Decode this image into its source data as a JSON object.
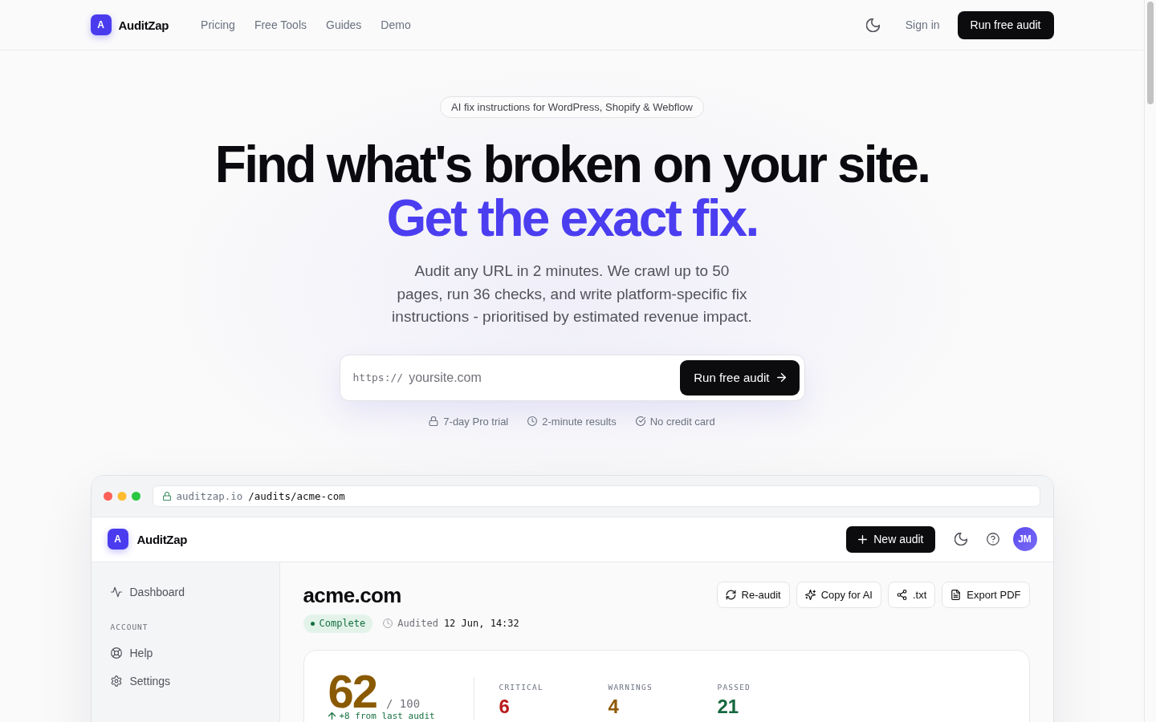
{
  "nav": {
    "logo_letter": "A",
    "brand": "AuditZap",
    "links": [
      {
        "label": "Pricing"
      },
      {
        "label": "Free Tools"
      },
      {
        "label": "Guides"
      },
      {
        "label": "Demo"
      }
    ],
    "sign_in": "Sign in",
    "cta": "Run free audit"
  },
  "hero": {
    "badge": "AI fix instructions for WordPress, Shopify & Webflow",
    "headline": "Find what's broken on your site.",
    "headline_accent": "Get the exact fix.",
    "description": "Audit any URL in 2 minutes. We crawl up to 50 pages, run 36 checks, and write platform-specific fix instructions - prioritised by estimated revenue impact.",
    "url_form": {
      "prefix": "https://",
      "placeholder": "yoursite.com",
      "button": "Run free audit"
    },
    "trust_items": [
      {
        "kind": "lock",
        "label": "7-day Pro trial"
      },
      {
        "kind": "clock",
        "label": "2-minute results"
      },
      {
        "kind": "check",
        "label": "No credit card"
      }
    ]
  },
  "preview": {
    "address_bar": {
      "host": "auditzap.io",
      "path": "/audits/acme-com"
    },
    "app_header": {
      "logo_letter": "A",
      "brand": "AuditZap",
      "new_button": "New audit",
      "avatar": "JM"
    },
    "sidebar": {
      "items": [
        {
          "kind": "activity",
          "label": "Dashboard"
        }
      ],
      "sections": [
        {
          "heading": "ACCOUNT",
          "items": [
            {
              "kind": "help",
              "label": "Help"
            },
            {
              "kind": "settings",
              "label": "Settings"
            }
          ]
        }
      ]
    },
    "audit": {
      "site": "acme.com",
      "status": "Complete",
      "audited_label": "Audited",
      "audited_time": "12 Jun, 14:32",
      "actions": [
        {
          "kind": "refresh",
          "label": "Re-audit"
        },
        {
          "kind": "sparkles",
          "label": "Copy for AI"
        },
        {
          "kind": "share",
          "label": ".txt"
        },
        {
          "kind": "file",
          "label": "Export PDF"
        }
      ],
      "score": {
        "value": "62",
        "max": "/ 100",
        "change": "+8 from last audit"
      },
      "metrics": [
        {
          "label": "CRITICAL",
          "value": "6",
          "color": "#b91c1c"
        },
        {
          "label": "WARNINGS",
          "value": "4",
          "color": "#8f5a06"
        },
        {
          "label": "PASSED",
          "value": "21",
          "color": "#17683f"
        }
      ]
    }
  }
}
